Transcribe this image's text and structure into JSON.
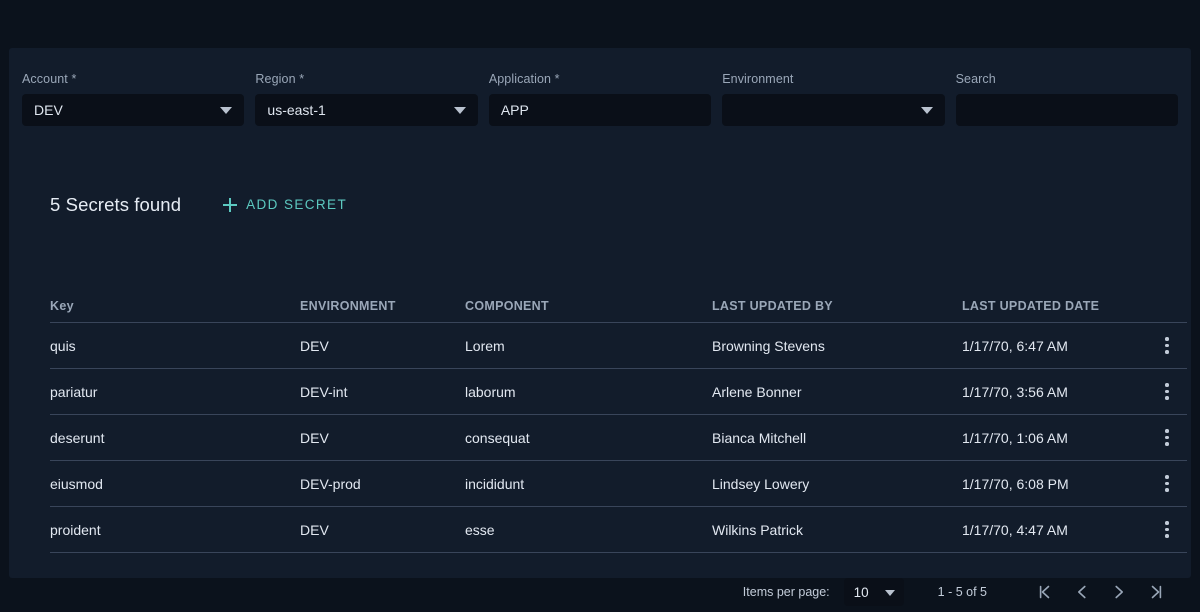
{
  "filters": [
    {
      "label": "Account",
      "required": true,
      "type": "select",
      "value": "DEV",
      "placeholder": ""
    },
    {
      "label": "Region",
      "required": true,
      "type": "select",
      "value": "us-east-1",
      "placeholder": ""
    },
    {
      "label": "Application",
      "required": true,
      "type": "text",
      "value": "APP",
      "placeholder": ""
    },
    {
      "label": "Environment",
      "required": false,
      "type": "select",
      "value": "",
      "placeholder": ""
    },
    {
      "label": "Search",
      "required": false,
      "type": "text",
      "value": "",
      "placeholder": ""
    }
  ],
  "toolbar": {
    "count_title": "5 Secrets found",
    "add_label": "ADD SECRET",
    "add_icon": "plus-icon",
    "accent_color": "#5cc9c0"
  },
  "table": {
    "columns": [
      "Key",
      "ENVIRONMENT",
      "COMPONENT",
      "LAST UPDATED BY",
      "LAST UPDATED DATE"
    ],
    "rows": [
      {
        "key": "quis",
        "environment": "DEV",
        "component": "Lorem",
        "last_updated_by": "Browning Stevens",
        "last_updated_date": "1/17/70, 6:47 AM"
      },
      {
        "key": "pariatur",
        "environment": "DEV-int",
        "component": "laborum",
        "last_updated_by": "Arlene Bonner",
        "last_updated_date": "1/17/70, 3:56 AM"
      },
      {
        "key": "deserunt",
        "environment": "DEV",
        "component": "consequat",
        "last_updated_by": "Bianca Mitchell",
        "last_updated_date": "1/17/70, 1:06 AM"
      },
      {
        "key": "eiusmod",
        "environment": "DEV-prod",
        "component": "incididunt",
        "last_updated_by": "Lindsey Lowery",
        "last_updated_date": "1/17/70, 6:08 PM"
      },
      {
        "key": "proident",
        "environment": "DEV",
        "component": "esse",
        "last_updated_by": "Wilkins Patrick",
        "last_updated_date": "1/17/70, 4:47 AM"
      }
    ],
    "row_menu_icon": "kebab-menu-icon"
  },
  "paginator": {
    "items_per_page_label": "Items per page:",
    "items_per_page_value": "10",
    "range_label": "1 - 5 of 5",
    "buttons": [
      {
        "name": "first-page-button",
        "icon": "first-page-icon"
      },
      {
        "name": "previous-page-button",
        "icon": "chevron-left-icon"
      },
      {
        "name": "next-page-button",
        "icon": "chevron-right-icon"
      },
      {
        "name": "last-page-button",
        "icon": "last-page-icon"
      }
    ]
  },
  "theme": {
    "page_background": "#0b121c",
    "card_background": "#121c2b",
    "input_background": "#0a0f18",
    "divider": "#39455a",
    "text_primary": "#e2e8f1",
    "text_muted": "#9aa7b8"
  }
}
